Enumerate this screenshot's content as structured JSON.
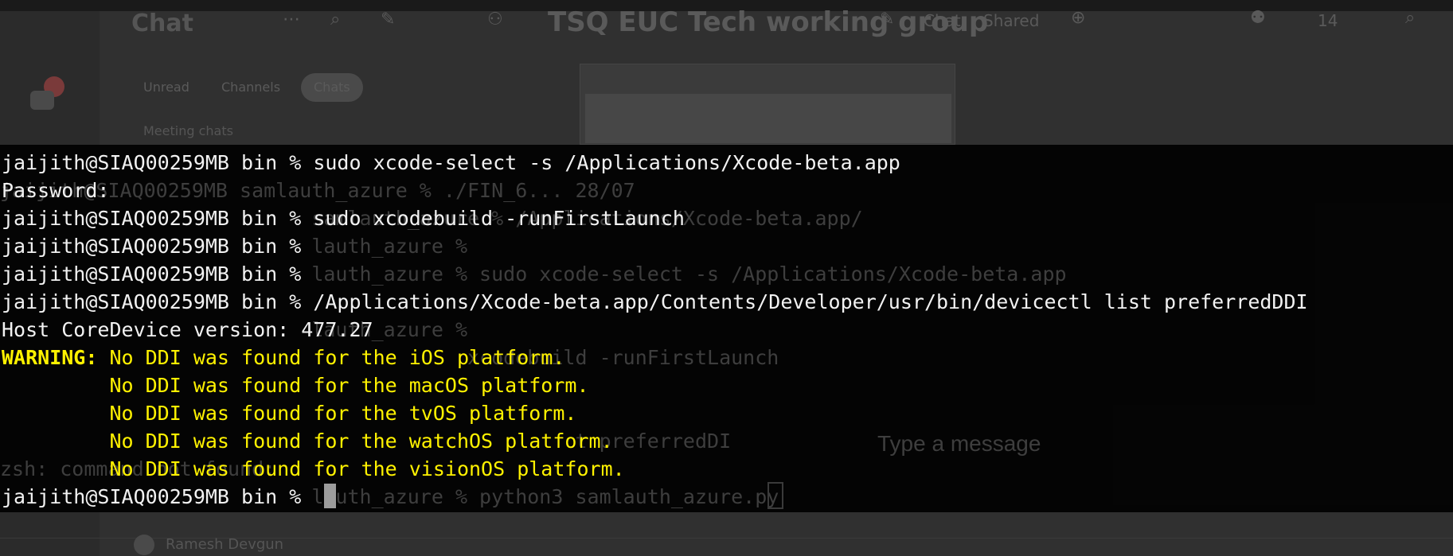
{
  "background_app": {
    "chat_title": "Chat",
    "conversation_title": "TSQ EUC Tech working group",
    "tabs": [
      "Chat",
      "Shared"
    ],
    "participant_count": "14",
    "filters": [
      "Unread",
      "Channels",
      "Chats"
    ],
    "section_label": "Meeting chats",
    "footer_name": "Ramesh Devgun",
    "compose_placeholder": "Type a message"
  },
  "terminal": {
    "lines": [
      {
        "type": "cmd",
        "text": "jaijith@SIAQ00259MB bin % sudo xcode-select -s /Applications/Xcode-beta.app"
      },
      {
        "type": "out",
        "text": "Password:"
      },
      {
        "type": "cmd",
        "text": "jaijith@SIAQ00259MB bin % sudo xcodebuild -runFirstLaunch"
      },
      {
        "type": "cmd",
        "text": "jaijith@SIAQ00259MB bin %"
      },
      {
        "type": "cmd",
        "text": "jaijith@SIAQ00259MB bin %"
      },
      {
        "type": "cmd",
        "text": "jaijith@SIAQ00259MB bin % /Applications/Xcode-beta.app/Contents/Developer/usr/bin/devicectl list preferredDDI"
      },
      {
        "type": "out",
        "text": "Host CoreDevice version: 477.27"
      },
      {
        "type": "warn",
        "label": "WARNING:",
        "text": " No DDI was found for the iOS platform."
      },
      {
        "type": "warn-cont",
        "text": "         No DDI was found for the macOS platform."
      },
      {
        "type": "warn-cont",
        "text": "         No DDI was found for the tvOS platform."
      },
      {
        "type": "warn-cont",
        "text": "         No DDI was found for the watchOS platform."
      },
      {
        "type": "warn-cont",
        "text": "         No DDI was found for the visionOS platform."
      },
      {
        "type": "prompt",
        "text": "jaijith@SIAQ00259MB bin % "
      }
    ],
    "ghost_lines": [
      {
        "row": 1,
        "text": "jaijith@SIAQ00259MB samlauth_azure % ./FIN_6... 28/07"
      },
      {
        "row": 2,
        "text": "                          samlauth_azure % /Applications/Xcode-beta.app/"
      },
      {
        "row": 3,
        "text": "                          lauth_azure %"
      },
      {
        "row": 4,
        "text": "                          lauth_azure % sudo xcode-select -s /Applications/Xcode-beta.app"
      },
      {
        "row": 6,
        "text": "                          lauth_azure %"
      },
      {
        "row": 7,
        "text": "                                       xcodebuild -runFirstLaunch"
      },
      {
        "row": 10,
        "text": "                                                t preferredDI"
      },
      {
        "row": 11,
        "text": "zsh: command not found:"
      },
      {
        "row": 12,
        "text": "                          lauth_azure % python3 samlauth_azure.py"
      }
    ]
  }
}
